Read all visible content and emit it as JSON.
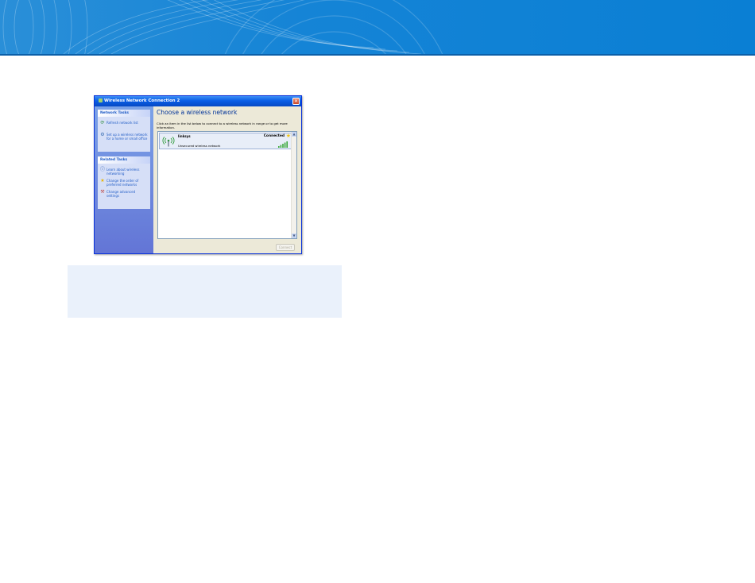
{
  "window": {
    "title": "Wireless Network Connection 2",
    "close_glyph": "✕"
  },
  "sidebar": {
    "network_tasks": {
      "heading": "Network Tasks",
      "items": [
        {
          "icon": "refresh-icon",
          "label": "Refresh network list"
        },
        {
          "icon": "setup-network-icon",
          "label": "Set up a wireless network for a home or small office"
        }
      ]
    },
    "related_tasks": {
      "heading": "Related Tasks",
      "items": [
        {
          "icon": "info-icon",
          "label": "Learn about wireless networking"
        },
        {
          "icon": "star-icon",
          "label": "Change the order of preferred networks"
        },
        {
          "icon": "settings-icon",
          "label": "Change advanced settings"
        }
      ]
    }
  },
  "main": {
    "title": "Choose a wireless network",
    "description": "Click an item in the list below to connect to a wireless network in range or to get more information.",
    "networks": [
      {
        "name": "linksys",
        "status": "Connected",
        "security": "Unsecured wireless network",
        "signal_bars": 5
      }
    ],
    "connect_label": "Connect"
  },
  "colors": {
    "banner": "#0a7fd4",
    "link": "#215dc6",
    "heading": "#003399",
    "callout": "#eaf1fb"
  }
}
